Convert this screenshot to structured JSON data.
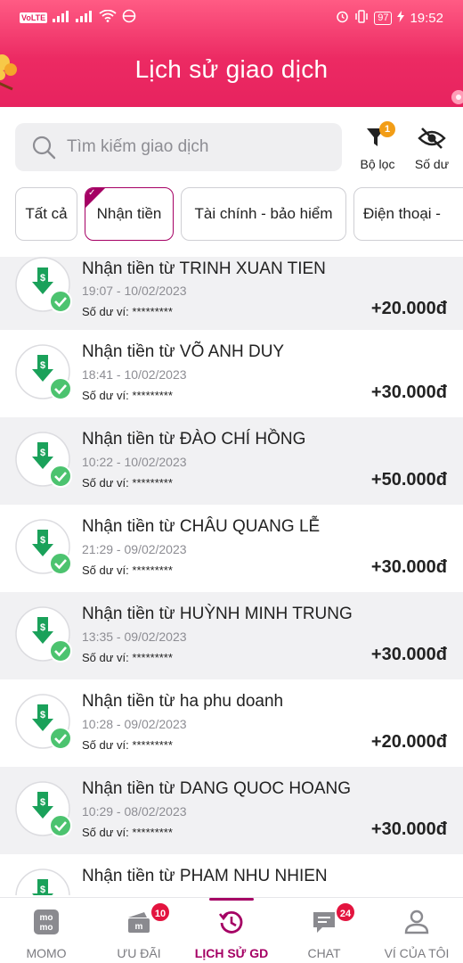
{
  "status_bar": {
    "carrier_tag": "VoLTE",
    "battery": "97",
    "time": "19:52"
  },
  "header": {
    "title": "Lịch sử giao dịch"
  },
  "search": {
    "placeholder": "Tìm kiếm giao dịch"
  },
  "tools": {
    "filter_label": "Bộ lọc",
    "filter_badge": "1",
    "balance_label": "Số dư"
  },
  "chips": [
    {
      "label": "Tất cả",
      "active": false
    },
    {
      "label": "Nhận tiền",
      "active": true
    },
    {
      "label": "Tài chính - bảo hiểm",
      "active": false
    },
    {
      "label": "Điện thoại -",
      "active": false
    }
  ],
  "transactions": [
    {
      "title": "Nhận tiền từ TRINH XUAN TIEN",
      "time": "19:07 - 10/02/2023",
      "balance": "Số dư ví: *********",
      "amount": "+20.000đ"
    },
    {
      "title": "Nhận tiền từ VÕ ANH DUY",
      "time": "18:41 - 10/02/2023",
      "balance": "Số dư ví: *********",
      "amount": "+30.000đ"
    },
    {
      "title": "Nhận tiền từ ĐÀO CHÍ HỒNG",
      "time": "10:22 - 10/02/2023",
      "balance": "Số dư ví: *********",
      "amount": "+50.000đ"
    },
    {
      "title": "Nhận tiền từ CHÂU QUANG LỄ",
      "time": "21:29 - 09/02/2023",
      "balance": "Số dư ví: *********",
      "amount": "+30.000đ"
    },
    {
      "title": "Nhận tiền từ HUỲNH MINH TRUNG",
      "time": "13:35 - 09/02/2023",
      "balance": "Số dư ví: *********",
      "amount": "+30.000đ"
    },
    {
      "title": "Nhận tiền từ ha phu doanh",
      "time": "10:28 - 09/02/2023",
      "balance": "Số dư ví: *********",
      "amount": "+20.000đ"
    },
    {
      "title": "Nhận tiền từ DANG QUOC HOANG",
      "time": "10:29 - 08/02/2023",
      "balance": "Số dư ví: *********",
      "amount": "+30.000đ"
    },
    {
      "title": "Nhận tiền từ PHAM NHU NHIEN",
      "time": "",
      "balance": "",
      "amount": ""
    }
  ],
  "bottom_nav": [
    {
      "label": "MOMO",
      "icon": "momo-logo-icon",
      "badge": "",
      "active": false
    },
    {
      "label": "ƯU ĐÃI",
      "icon": "voucher-icon",
      "badge": "10",
      "active": false
    },
    {
      "label": "LỊCH SỬ GD",
      "icon": "history-icon",
      "badge": "",
      "active": true
    },
    {
      "label": "CHAT",
      "icon": "chat-icon",
      "badge": "24",
      "active": false
    },
    {
      "label": "VÍ CỦA TÔI",
      "icon": "user-icon",
      "badge": "",
      "active": false
    }
  ],
  "colors": {
    "brand": "#a50064",
    "header": "#e7235f",
    "receive_icon": "#1aa15a",
    "badge_red": "#e3143f",
    "badge_orange": "#f29d16"
  }
}
